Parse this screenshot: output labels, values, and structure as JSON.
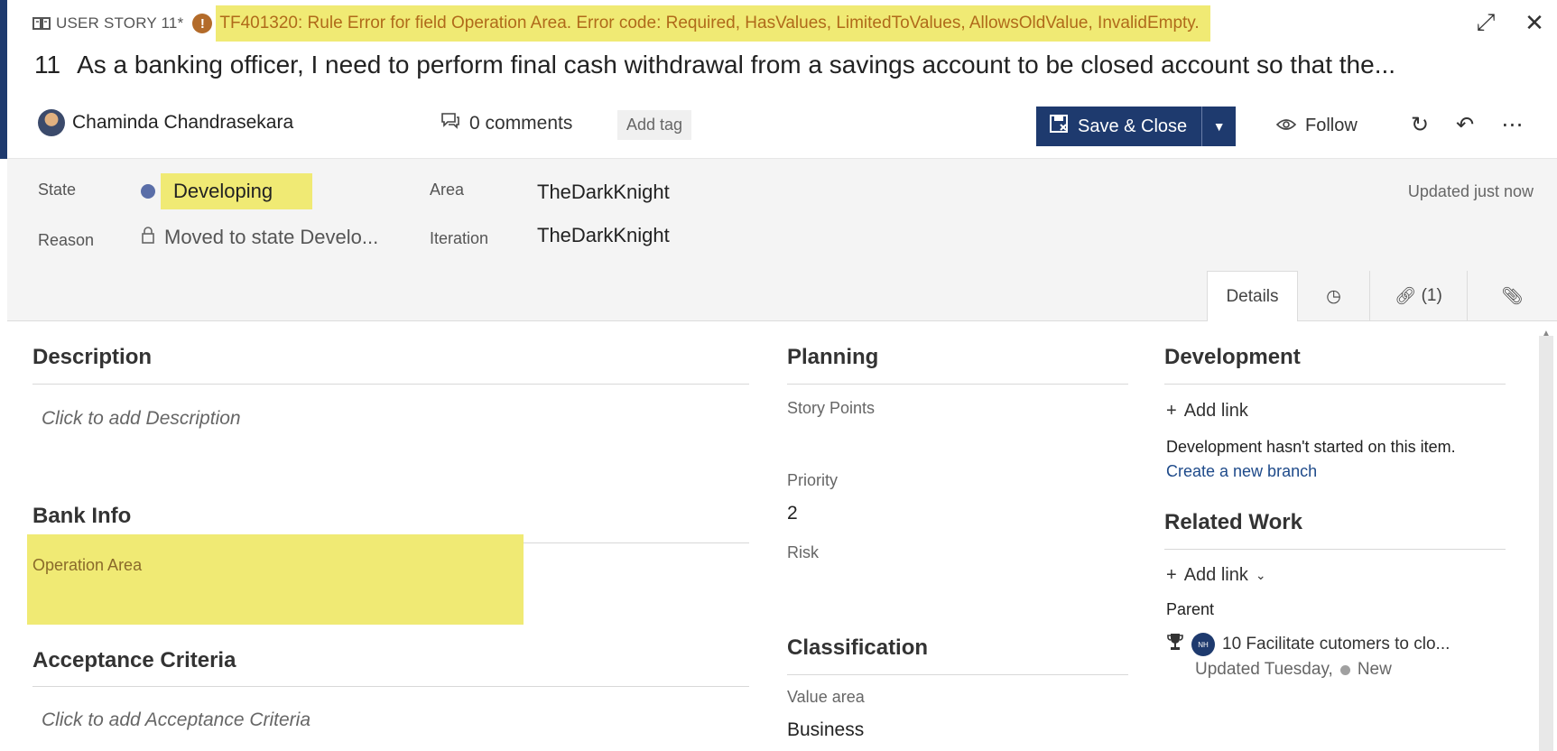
{
  "header": {
    "work_item_type": "USER STORY 11*",
    "error_message": "TF401320: Rule Error for field Operation Area. Error code: Required, HasValues, LimitedToValues, AllowsOldValue, InvalidEmpty.",
    "id": "11",
    "title": "As a banking officer, I need to perform final cash withdrawal from a savings account to be closed account so that the...",
    "author": "Chaminda Chandrasekara",
    "comments": "0 comments",
    "add_tag": "Add tag",
    "save_close": "Save & Close",
    "follow": "Follow"
  },
  "fields": {
    "state_label": "State",
    "state_value": "Developing",
    "reason_label": "Reason",
    "reason_value": "Moved to state Develo...",
    "area_label": "Area",
    "area_value": "TheDarkKnight",
    "iteration_label": "Iteration",
    "iteration_value": "TheDarkKnight",
    "updated": "Updated just now"
  },
  "tabs": {
    "details": "Details",
    "links": "(1)"
  },
  "left_column": {
    "description_title": "Description",
    "description_placeholder": "Click to add Description",
    "bank_info_title": "Bank Info",
    "operation_area_label": "Operation Area",
    "acceptance_title": "Acceptance Criteria",
    "acceptance_placeholder": "Click to add Acceptance Criteria"
  },
  "planning": {
    "title": "Planning",
    "story_points_label": "Story Points",
    "priority_label": "Priority",
    "priority_value": "2",
    "risk_label": "Risk"
  },
  "classification": {
    "title": "Classification",
    "value_area_label": "Value area",
    "value_area_value": "Business"
  },
  "development": {
    "title": "Development",
    "add_link": "Add link",
    "status_text": "Development hasn't started on this item.",
    "create_branch": "Create a new branch"
  },
  "related_work": {
    "title": "Related Work",
    "add_link": "Add link",
    "parent_label": "Parent",
    "parent_badge": "NH",
    "parent_title": "10 Facilitate cutomers to clo...",
    "parent_updated": "Updated Tuesday,",
    "parent_state": "New"
  },
  "colors": {
    "accent": "#1e3a6e",
    "highlight": "#f0ea74",
    "warning": "#b36b2a"
  }
}
